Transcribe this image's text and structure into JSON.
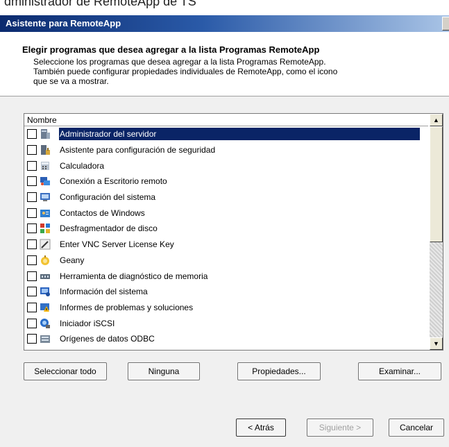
{
  "background_window": {
    "title": "dministrador de RemoteApp de TS"
  },
  "wizard": {
    "title": "Asistente para RemoteApp"
  },
  "header": {
    "title": "Elegir programas que desea agregar a la lista Programas RemoteApp",
    "line1": "Seleccione los programas que desea agregar a la lista Programas RemoteApp.",
    "line2": "También puede configurar propiedades individuales de RemoteApp, como el icono",
    "line3": "que se va a mostrar."
  },
  "list": {
    "column_header": "Nombre",
    "items": [
      {
        "label": "Administrador del servidor",
        "icon": "server-manager-icon",
        "checked": false,
        "selected": true
      },
      {
        "label": "Asistente para configuración de seguridad",
        "icon": "security-config-icon",
        "checked": false,
        "selected": false
      },
      {
        "label": "Calculadora",
        "icon": "calculator-icon",
        "checked": false,
        "selected": false
      },
      {
        "label": "Conexión a Escritorio remoto",
        "icon": "remote-desktop-icon",
        "checked": false,
        "selected": false
      },
      {
        "label": "Configuración del sistema",
        "icon": "system-config-icon",
        "checked": false,
        "selected": false
      },
      {
        "label": "Contactos de Windows",
        "icon": "contacts-icon",
        "checked": false,
        "selected": false
      },
      {
        "label": "Desfragmentador de disco",
        "icon": "defrag-icon",
        "checked": false,
        "selected": false
      },
      {
        "label": "Enter VNC Server License Key",
        "icon": "vnc-key-icon",
        "checked": false,
        "selected": false
      },
      {
        "label": "Geany",
        "icon": "geany-icon",
        "checked": false,
        "selected": false
      },
      {
        "label": "Herramienta de diagnóstico de memoria",
        "icon": "memory-diagnostic-icon",
        "checked": false,
        "selected": false
      },
      {
        "label": "Información del sistema",
        "icon": "system-info-icon",
        "checked": false,
        "selected": false
      },
      {
        "label": "Informes de problemas y soluciones",
        "icon": "problem-reports-icon",
        "checked": false,
        "selected": false
      },
      {
        "label": "Iniciador iSCSI",
        "icon": "iscsi-icon",
        "checked": false,
        "selected": false
      },
      {
        "label": "Orígenes de datos ODBC",
        "icon": "odbc-icon",
        "checked": false,
        "selected": false
      }
    ]
  },
  "buttons": {
    "select_all": "Seleccionar todo",
    "none": "Ninguna",
    "properties": "Propiedades...",
    "browse": "Examinar...",
    "back": "< Atrás",
    "next": "Siguiente >",
    "cancel": "Cancelar"
  },
  "colors": {
    "selection": "#0a2466",
    "title_gradient_start": "#0b2a6e",
    "title_gradient_end": "#a9c4e6"
  }
}
